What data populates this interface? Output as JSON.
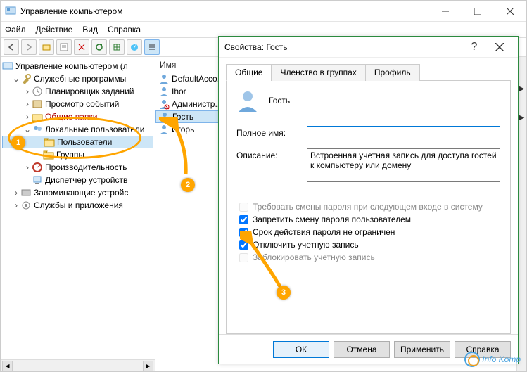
{
  "window": {
    "title": "Управление компьютером"
  },
  "menu": {
    "file": "Файл",
    "action": "Действие",
    "view": "Вид",
    "help": "Справка"
  },
  "tree": {
    "root": "Управление компьютером (л",
    "system_tools": "Служебные программы",
    "scheduler": "Планировщик заданий",
    "event_viewer": "Просмотр событий",
    "shared": "Общие папки",
    "local_users": "Локальные пользователи",
    "users": "Пользователи",
    "groups": "Группы",
    "performance": "Производительность",
    "devmgr": "Диспетчер устройств",
    "storage": "Запоминающие устройс",
    "services": "Службы и приложения"
  },
  "list": {
    "header_name": "Имя",
    "items": [
      "DefaultAcco...",
      "Ihor",
      "Администр...",
      "Гость",
      "Игорь"
    ]
  },
  "dialog": {
    "title": "Свойства: Гость",
    "tabs": {
      "general": "Общие",
      "member": "Членство в группах",
      "profile": "Профиль"
    },
    "user_name": "Гость",
    "fullname_label": "Полное имя:",
    "fullname_value": "",
    "desc_label": "Описание:",
    "desc_value": "Встроенная учетная запись для доступа гостей к компьютеру или домену",
    "chk_must_change": "Требовать смены пароля при следующем входе в систему",
    "chk_cannot_change": "Запретить смену пароля пользователем",
    "chk_never_expires": "Срок действия пароля не ограничен",
    "chk_disabled": "Отключить учетную запись",
    "chk_locked": "Заблокировать учетную запись",
    "btn_ok": "ОК",
    "btn_cancel": "Отмена",
    "btn_apply": "Применить",
    "btn_help": "Справка"
  },
  "watermark": "Info Komp"
}
